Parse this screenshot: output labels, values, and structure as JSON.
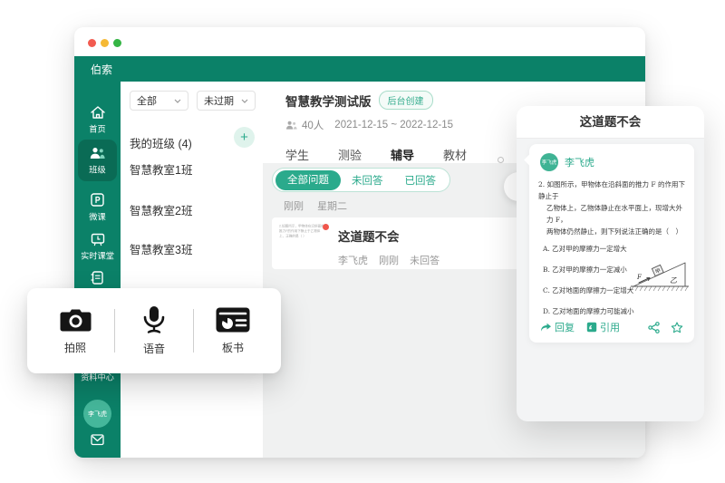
{
  "window": {
    "app_name": "伯索"
  },
  "sidebar": {
    "items": [
      {
        "label": "首页"
      },
      {
        "label": "班级"
      },
      {
        "label": "微课"
      },
      {
        "label": "实时课堂"
      },
      {
        "label": ""
      },
      {
        "label": "资料中心"
      }
    ],
    "avatar_name": "李飞虎"
  },
  "class_panel": {
    "filter_scope": "全部",
    "filter_status": "未过期",
    "group_title": "我的班级 (4)",
    "add_label": "+",
    "classes": [
      {
        "name": "智慧教室1班"
      },
      {
        "name": "智慧教室2班"
      },
      {
        "name": "智慧教室3班"
      }
    ]
  },
  "main": {
    "course_title": "智慧教学测试版",
    "course_badge": "后台创建",
    "member_count": "40人",
    "date_range": "2021-12-15 ~ 2022-12-15",
    "tabs": [
      {
        "label": "学生"
      },
      {
        "label": "测验"
      },
      {
        "label": "辅导"
      },
      {
        "label": "教材"
      }
    ],
    "filters": [
      {
        "label": "全部问题"
      },
      {
        "label": "未回答"
      },
      {
        "label": "已回答"
      }
    ],
    "time_now": "刚刚",
    "time_day": "星期二",
    "card": {
      "title": "这道题不会",
      "author": "李飞虎",
      "time": "刚刚",
      "status": "未回答",
      "thumb_text": "2.如图所示，甲物体在沿斜面的推力F的作用下静止于乙物体上，正确的是（ ）"
    }
  },
  "overlay": {
    "title": "这道题不会",
    "student": "李飞虎",
    "question_lines": [
      "2. 如图所示，甲物体在沿斜面的推力 F 的作用下静止于",
      "乙物体上，乙物体静止在水平面上，现增大外力 F，",
      "两物体仍然静止，则下列说法正确的是（　）"
    ],
    "options": [
      "A. 乙对甲的摩擦力一定增大",
      "B. 乙对甲的摩擦力一定减小",
      "C. 乙对地面的摩擦力一定增大",
      "D. 乙对地面的摩擦力可能减小"
    ],
    "diagram_labels": {
      "force": "F",
      "block": "甲",
      "wedge": "乙"
    },
    "reply_label": "回复",
    "quote_label": "引用"
  },
  "toolbar": {
    "items": [
      {
        "label": "拍照"
      },
      {
        "label": "语音"
      },
      {
        "label": "板书"
      }
    ]
  }
}
